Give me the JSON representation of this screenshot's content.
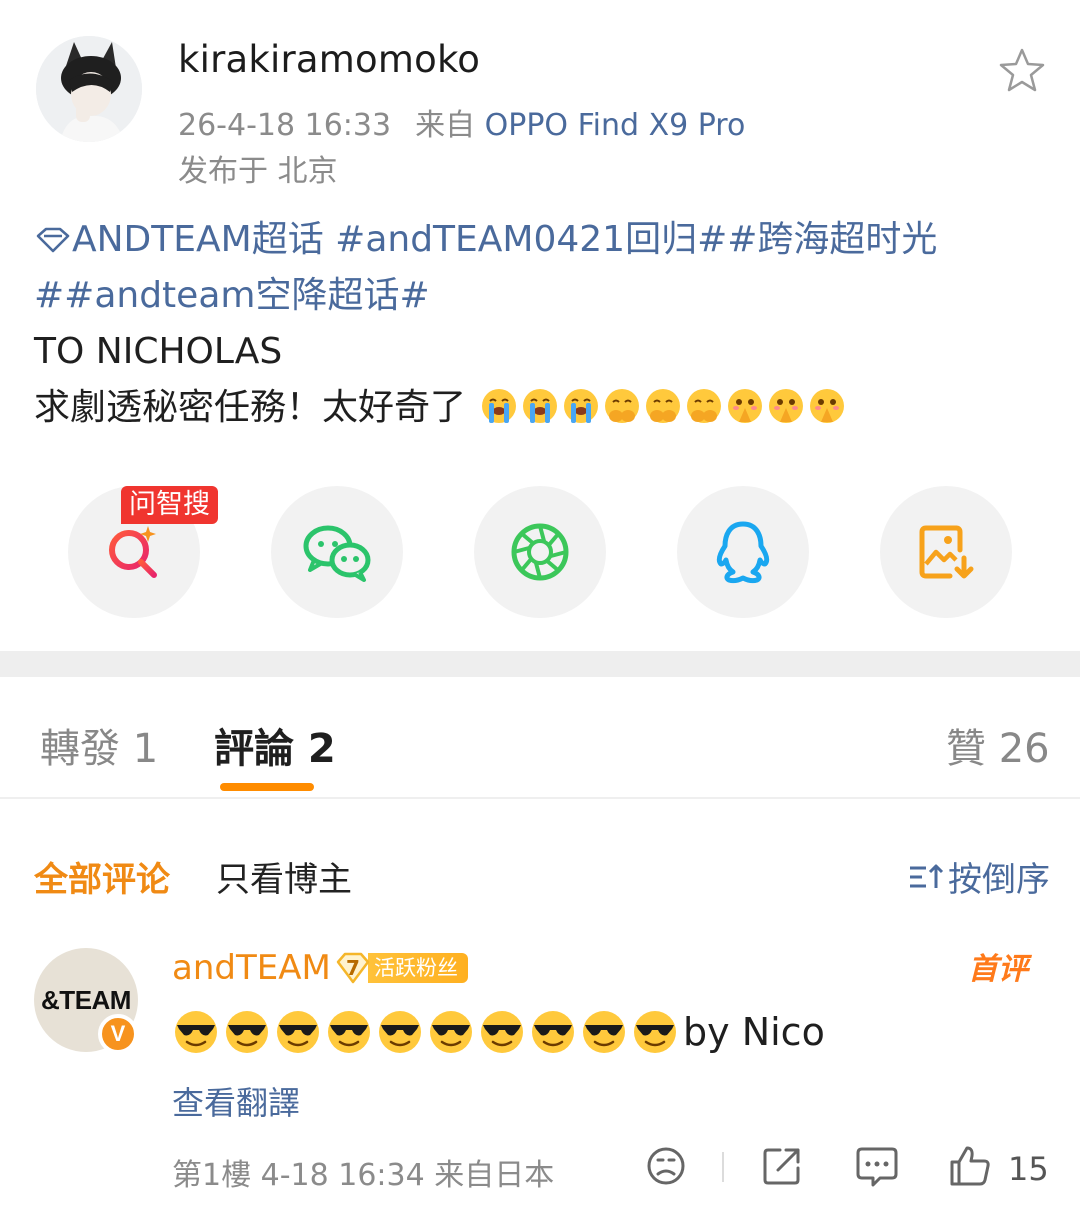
{
  "post": {
    "username": "kirakiramomoko",
    "time": "26-4-18 16:33",
    "source_prefix": "来自",
    "device": "OPPO Find X9 Pro",
    "location": "发布于 北京",
    "supertopic": "ANDTEAM超话",
    "tags_line1": "#andTEAM0421回归##跨海超时光",
    "tags_line2": "##andteam空降超话#",
    "text_line1": "TO NICHOLAS",
    "text_line2": "求劇透秘密任務！太好奇了"
  },
  "share": {
    "ai_badge": "问智搜",
    "buttons": [
      "ai-search",
      "wechat",
      "moments",
      "qq",
      "save-image"
    ]
  },
  "tabs": {
    "repost": "轉發 1",
    "comments": "評論 2",
    "likes": "贊 26"
  },
  "filters": {
    "all": "全部评论",
    "owner_only": "只看博主",
    "sort": "按倒序"
  },
  "comment": {
    "avatar_text": "&TEAM",
    "verified": "V",
    "name": "andTEAM",
    "fan_level": "7",
    "fan_label": "活跃粉丝",
    "top_badge": "首评",
    "emoji_count": 10,
    "text_suffix": "by Nico",
    "translate": "查看翻譯",
    "meta": "第1樓  4-18 16:34  来自日本",
    "likes": "15"
  },
  "colors": {
    "link_blue": "#4a6a9c",
    "orange": "#f08a14",
    "badge_red": "#f0352f",
    "wechat_green": "#2bc46b",
    "moments_green": "#3cc75a",
    "qq_blue": "#1aa7f0",
    "save_orange": "#f7a21b"
  }
}
